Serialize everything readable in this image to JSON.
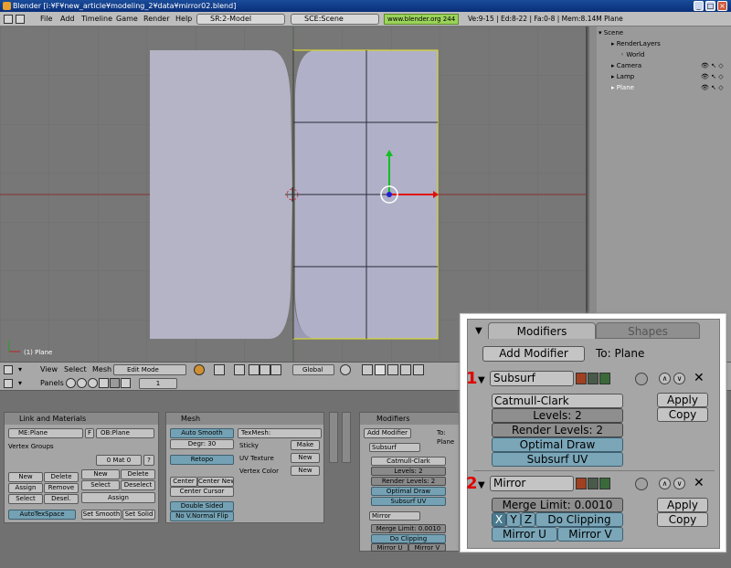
{
  "window": {
    "title": "Blender [i:¥F¥new_article¥modeling_2¥data¥mirror02.blend]"
  },
  "menu": {
    "items": [
      "File",
      "Add",
      "Timeline",
      "Game",
      "Render",
      "Help"
    ],
    "screen": "SR:2-Model",
    "scene": "SCE:Scene",
    "www": "www.blender.org 244",
    "stats": "Ve:9-15 | Ed:8-22 | Fa:0-8 | Mem:8.14M Plane"
  },
  "outliner": {
    "items": [
      "Scene",
      "RenderLayers",
      "World",
      "Camera",
      "Lamp",
      "Plane"
    ]
  },
  "viewport": {
    "object_label": "(1) Plane"
  },
  "vp_header": {
    "menus": [
      "View",
      "Select",
      "Mesh"
    ],
    "mode": "Edit Mode",
    "orientation": "Global"
  },
  "btn_header": {
    "panels_label": "Panels",
    "frame": "1"
  },
  "link_panel": {
    "title": "Link and Materials",
    "me": "ME:Plane",
    "f": "F",
    "ob": "OB:Plane",
    "vertex_groups": "Vertex Groups",
    "mat": "0 Mat 0",
    "q": "?",
    "buttons": [
      "New",
      "Delete",
      "Assign",
      "Remove",
      "Select",
      "Desel.",
      "New",
      "Delete",
      "Select",
      "Deselect",
      "Assign"
    ],
    "autotex": "AutoTexSpace",
    "set_smooth": "Set Smooth",
    "set_solid": "Set Solid"
  },
  "mesh_panel": {
    "title": "Mesh",
    "auto_smooth": "Auto Smooth",
    "degr": "Degr: 30",
    "retopo": "Retopo",
    "center": "Center",
    "center_new": "Center New",
    "center_cursor": "Center Cursor",
    "double_sided": "Double Sided",
    "no_vnormal": "No V.Normal Flip",
    "texmesh": "TexMesh:",
    "sticky": "Sticky",
    "make": "Make",
    "uv_texture": "UV Texture",
    "new1": "New",
    "vertex_color": "Vertex Color",
    "new2": "New"
  },
  "mod_panel": {
    "tab1": "Modifiers",
    "tab2": "Shapes",
    "add": "Add Modifier",
    "to": "To: Plane",
    "sub_name": "Subsurf",
    "catmull": "Catmull-Clark",
    "levels": "Levels: 2",
    "render_levels": "Render Levels: 2",
    "optimal": "Optimal Draw",
    "subsurf_uv": "Subsurf UV",
    "mir_name": "Mirror",
    "merge": "Merge Limit: 0.0010",
    "x": "X",
    "y": "Y",
    "z": "Z",
    "do_clipping": "Do Clipping",
    "mirror_u": "Mirror U",
    "mirror_v": "Mirror V",
    "apply": "Apply",
    "copy": "Copy",
    "num1": "1",
    "num2": "2",
    "tab2_short": "Sh"
  }
}
